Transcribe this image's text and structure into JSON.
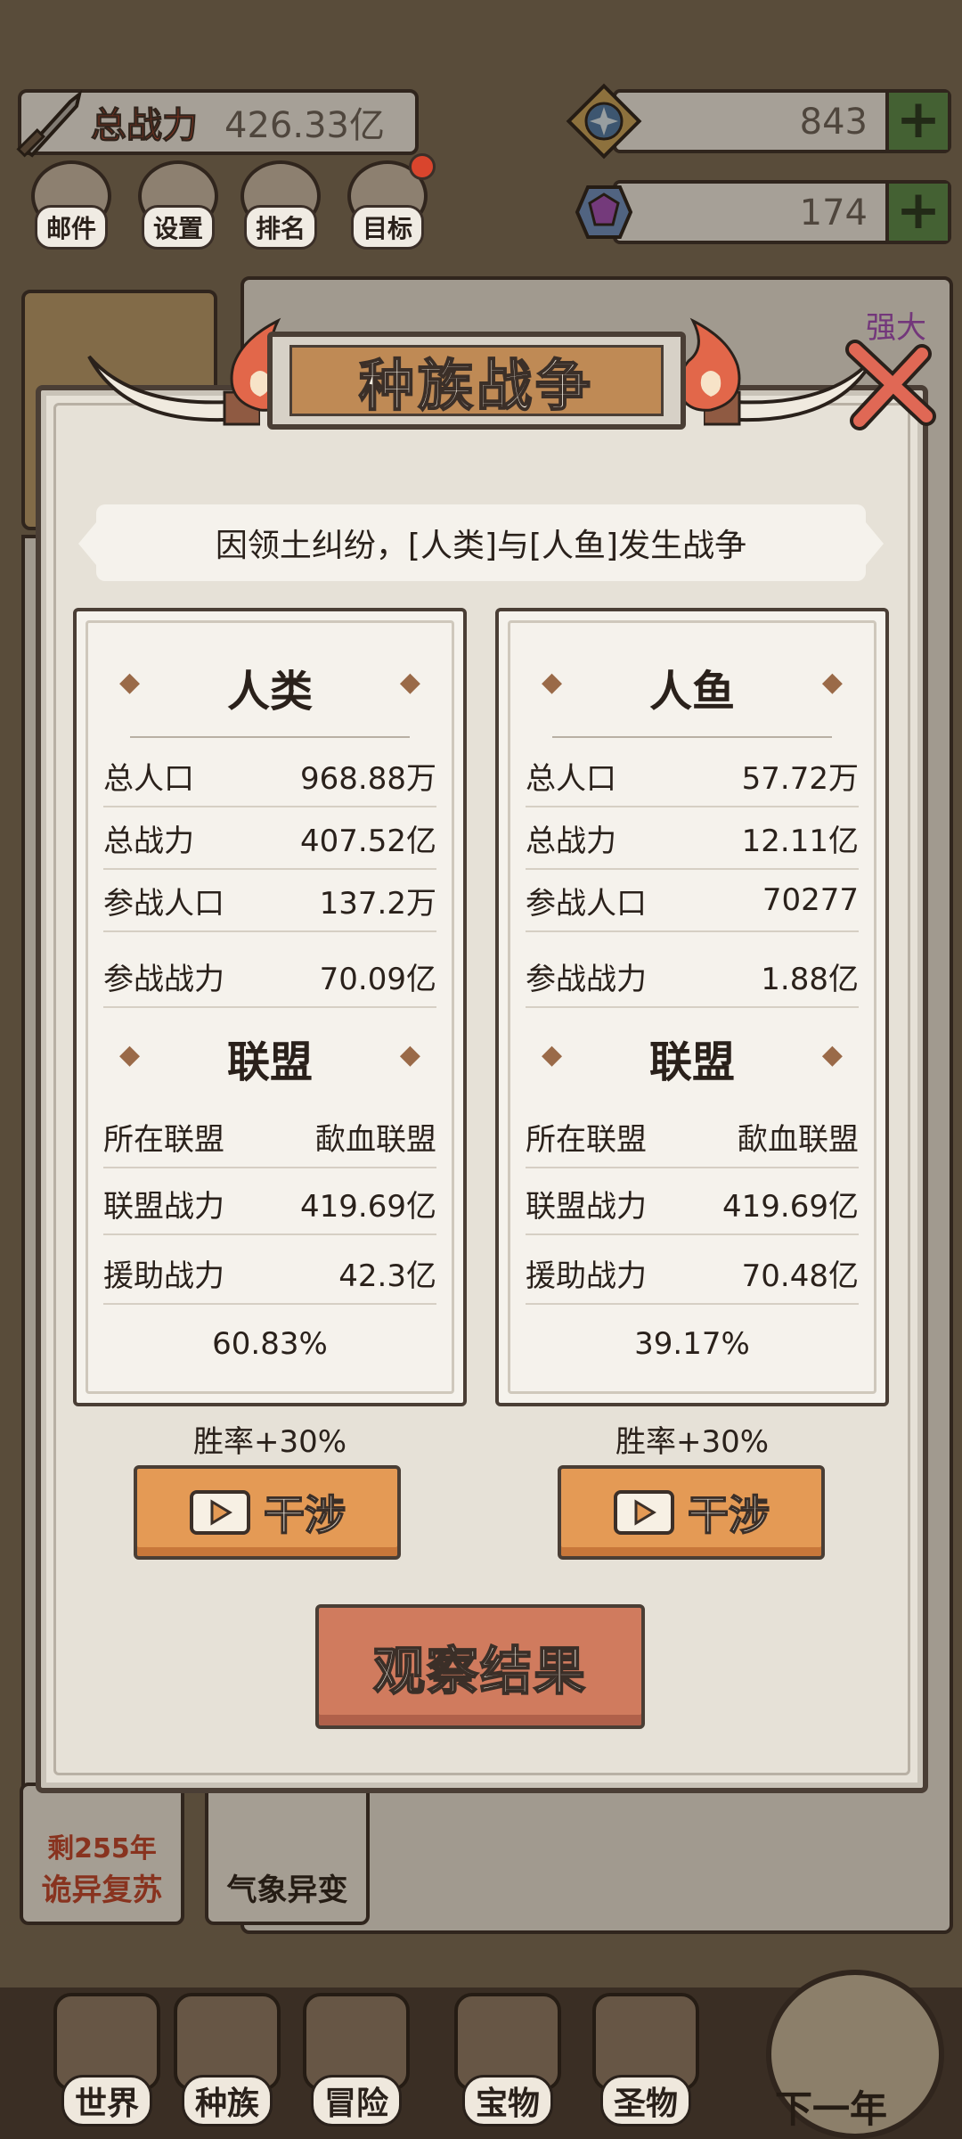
{
  "hud": {
    "power_label": "总战力",
    "power_value": "426.33亿",
    "gem_count": "843",
    "crystal_count": "174",
    "plus_icon": "plus-icon"
  },
  "top_buttons": [
    {
      "label": "邮件",
      "icon": "mail-icon"
    },
    {
      "label": "设置",
      "icon": "gear-icon"
    },
    {
      "label": "排名",
      "icon": "ranking-icon"
    },
    {
      "label": "目标",
      "icon": "target-icon"
    }
  ],
  "background": {
    "strong_label": "强大",
    "events": [
      {
        "remain": "剩255年",
        "name": "诡异复苏"
      },
      {
        "name": "气象异变"
      }
    ]
  },
  "modal": {
    "title": "种族战争",
    "intro": "因领土纠纷，[人类]与[人鱼]发生战争",
    "observe_label": "观察结果",
    "left": {
      "race": "人类",
      "rows": [
        {
          "k": "总人口",
          "v": "968.88万"
        },
        {
          "k": "总战力",
          "v": "407.52亿"
        },
        {
          "k": "参战人口",
          "v": "137.2万"
        },
        {
          "k": "参战战力",
          "v": "70.09亿"
        }
      ],
      "alliance_title": "联盟",
      "alliance_rows": [
        {
          "k": "所在联盟",
          "v": "歃血联盟"
        },
        {
          "k": "联盟战力",
          "v": "419.69亿"
        },
        {
          "k": "援助战力",
          "v": "42.3亿"
        }
      ],
      "percent": "60.83%",
      "winrate": "胜率+30%",
      "meddle_label": "干涉"
    },
    "right": {
      "race": "人鱼",
      "rows": [
        {
          "k": "总人口",
          "v": "57.72万"
        },
        {
          "k": "总战力",
          "v": "12.11亿"
        },
        {
          "k": "参战人口",
          "v": "70277"
        },
        {
          "k": "参战战力",
          "v": "1.88亿"
        }
      ],
      "alliance_title": "联盟",
      "alliance_rows": [
        {
          "k": "所在联盟",
          "v": "歃血联盟"
        },
        {
          "k": "联盟战力",
          "v": "419.69亿"
        },
        {
          "k": "援助战力",
          "v": "70.48亿"
        }
      ],
      "percent": "39.17%",
      "winrate": "胜率+30%",
      "meddle_label": "干涉"
    }
  },
  "bottom_nav": [
    {
      "label": "世界"
    },
    {
      "label": "种族"
    },
    {
      "label": "冒险"
    },
    {
      "label": "宝物"
    },
    {
      "label": "圣物"
    }
  ],
  "next_year_label": "下一年"
}
